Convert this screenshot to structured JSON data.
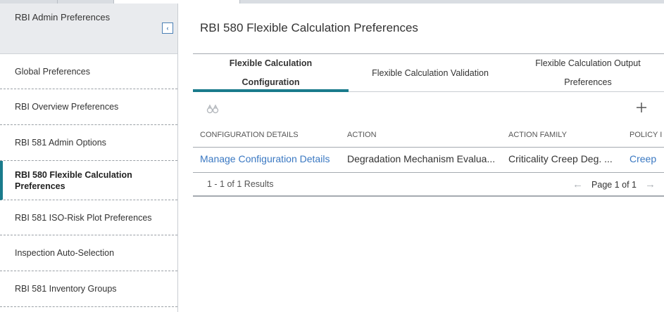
{
  "sidebar": {
    "title": "RBI Admin Preferences",
    "items": [
      {
        "label": "Global Preferences"
      },
      {
        "label": "RBI Overview Preferences"
      },
      {
        "label": "RBI 581 Admin Options"
      },
      {
        "label": "RBI 580 Flexible Calculation Preferences"
      },
      {
        "label": "RBI 581 ISO-Risk Plot Preferences"
      },
      {
        "label": "Inspection Auto-Selection"
      },
      {
        "label": "RBI 581 Inventory Groups"
      }
    ],
    "active_index": 3
  },
  "main": {
    "title": "RBI 580 Flexible Calculation Preferences",
    "tabs": [
      {
        "label": "Flexible Calculation Configuration"
      },
      {
        "label": "Flexible Calculation Validation"
      },
      {
        "label": "Flexible Calculation Output Preferences"
      }
    ],
    "active_tab": 0
  },
  "grid": {
    "columns": [
      "Configuration Details",
      "Action",
      "Action Family",
      "Policy I"
    ],
    "rows": [
      {
        "configuration_details": "Manage Configuration Details",
        "action": "Degradation Mechanism Evalua...",
        "action_family": "Criticality Creep Deg. ...",
        "policy": "Creep"
      }
    ],
    "results_text": "1 - 1 of 1 Results",
    "page_text": "Page 1 of 1"
  },
  "icons": {
    "collapse": "chevron-left-icon",
    "find": "binoculars-icon",
    "add": "plus-icon",
    "prev": "arrow-left-icon",
    "next": "arrow-right-icon"
  },
  "colors": {
    "accent": "#1a7b8c",
    "link": "#3a78c2"
  }
}
